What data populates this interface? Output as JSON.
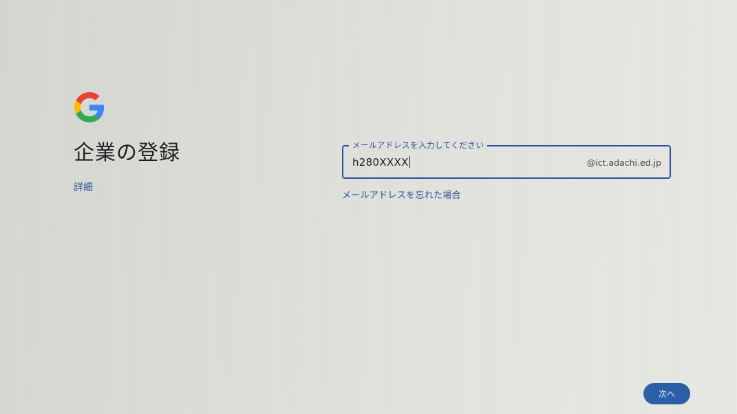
{
  "header": {
    "logo_icon": "google-g-icon",
    "title": "企業の登録",
    "details_link": "詳細"
  },
  "email_form": {
    "label": "メールアドレスを入力してください",
    "value": "h280XXXX",
    "domain_suffix": "@ict.adachi.ed.jp",
    "forgot_link": "メールアドレスを忘れた場合"
  },
  "footer": {
    "next_label": "次へ"
  },
  "colors": {
    "accent": "#2f4fa0",
    "button": "#2c5fa8",
    "link": "#2a4f9a",
    "google_blue": "#4285F4",
    "google_red": "#EA4335",
    "google_yellow": "#FBBC05",
    "google_green": "#34A853"
  }
}
